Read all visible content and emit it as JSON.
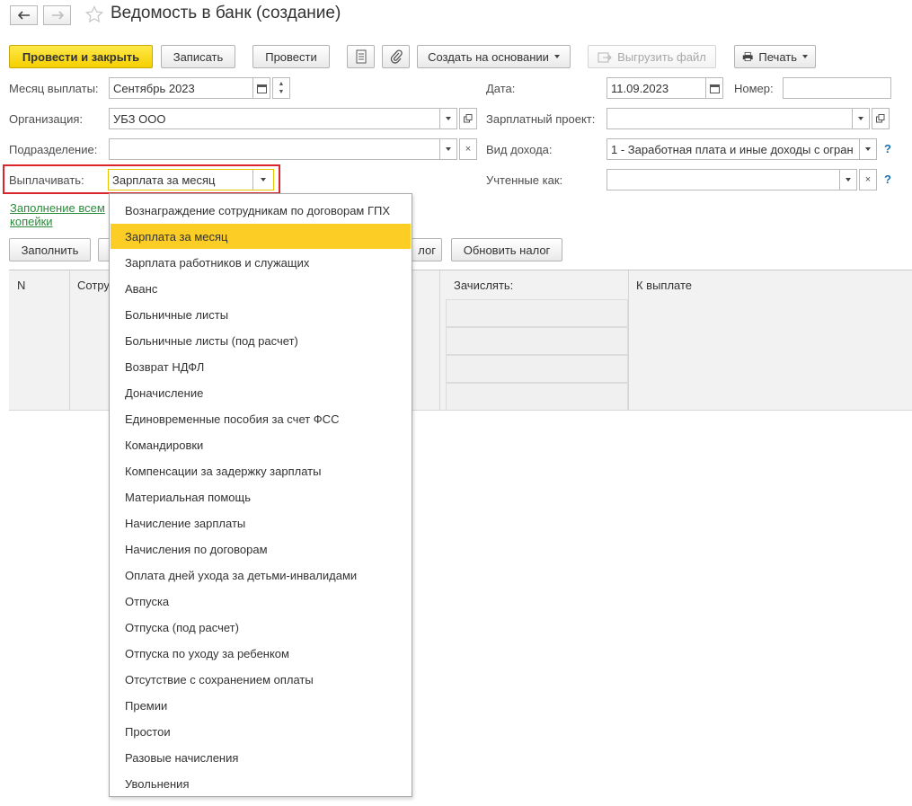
{
  "window": {
    "title": "Ведомость в банк (создание)"
  },
  "nav": {
    "back_glyph": "🡐",
    "forward_glyph": "🡒"
  },
  "toolbar": {
    "post_close": "Провести и закрыть",
    "save": "Записать",
    "post": "Провести",
    "create_based": "Создать на основании",
    "upload": "Выгрузить файл",
    "print": "Печать"
  },
  "form": {
    "month_label": "Месяц выплаты:",
    "month_value": "Сентябрь 2023",
    "date_label": "Дата:",
    "date_value": "11.09.2023",
    "number_label": "Номер:",
    "number_value": "",
    "org_label": "Организация:",
    "org_value": "УБЗ ООО",
    "salary_project_label": "Зарплатный проект:",
    "salary_project_value": "",
    "dept_label": "Подразделение:",
    "dept_value": "",
    "income_label": "Вид дохода:",
    "income_value": "1 - Заработная плата и иные доходы с огран",
    "pay_label": "Выплачивать:",
    "pay_value": "Зарплата за месяц",
    "accounted_label": "Учтенные как:",
    "accounted_value": "",
    "help": "?"
  },
  "links": {
    "fill_line1": "Заполнение всем",
    "fill_line2": "копейки"
  },
  "actions": {
    "fill": "Заполнить",
    "tax": "лог",
    "update_tax": "Обновить налог"
  },
  "table": {
    "col_n": "N",
    "col_employee": "Сотру",
    "col_accrue": "Зачислять:",
    "col_payout": "К выплате"
  },
  "dropdown": {
    "selected_index": 1,
    "options": [
      "Вознаграждение сотрудникам по договорам ГПХ",
      "Зарплата за месяц",
      "Зарплата работников и служащих",
      "Аванс",
      "Больничные листы",
      "Больничные листы (под расчет)",
      "Возврат НДФЛ",
      "Доначисление",
      "Единовременные пособия за счет ФСС",
      "Командировки",
      "Компенсации за задержку зарплаты",
      "Материальная помощь",
      "Начисление зарплаты",
      "Начисления по договорам",
      "Оплата дней ухода за детьми-инвалидами",
      "Отпуска",
      "Отпуска (под расчет)",
      "Отпуска по уходу за ребенком",
      "Отсутствие с сохранением оплаты",
      "Премии",
      "Простои",
      "Разовые начисления",
      "Увольнения"
    ]
  },
  "colors": {
    "accent_yellow": "#f5cf00",
    "highlight_red": "#d9262c",
    "selected_item": "#fbcd25",
    "link_green": "#2c8a3c"
  }
}
